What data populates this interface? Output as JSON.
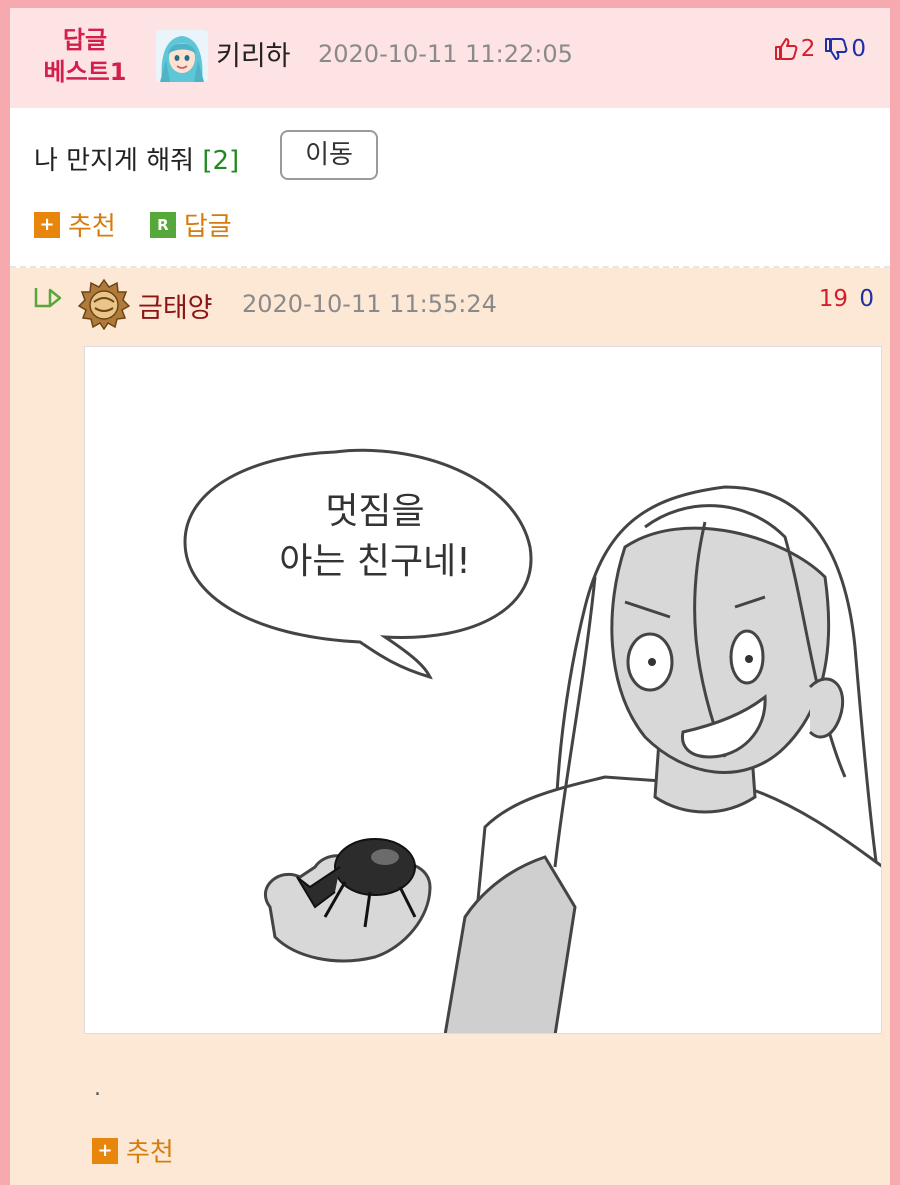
{
  "best_comment": {
    "badge_line1": "답글",
    "badge_line2": "베스트1",
    "username": "키리하",
    "datetime": "2020-10-11 11:22:05",
    "upvotes": "2",
    "downvotes": "0",
    "text": "나 만지게 해줘",
    "reply_count": "[2]",
    "move_button": "이동",
    "recommend_label": "추천",
    "reply_label": "답글",
    "reply_icon_letter": "R"
  },
  "reply": {
    "username": "금태양",
    "datetime": "2020-10-11 11:55:24",
    "upvotes": "19",
    "downvotes": "0",
    "image": {
      "bubble_line1": "멋짐을",
      "bubble_line2": "아는 친구네!"
    },
    "body_text": ".",
    "recommend_label": "추천"
  },
  "icons": {
    "thumb_up": "thumbs-up-icon",
    "thumb_down": "thumbs-down-icon",
    "plus": "plus-box-icon",
    "reply_r": "reply-r-icon",
    "reply_arrow": "reply-arrow-icon"
  },
  "colors": {
    "page_border": "#f6a9ae",
    "best_header_bg": "#fde3e3",
    "reply_bg": "#fde8d6",
    "badge_red": "#d21f4d",
    "action_orange": "#d67c0d",
    "upvote_red": "#d21f2f",
    "downvote_blue": "#1f2fa5"
  }
}
